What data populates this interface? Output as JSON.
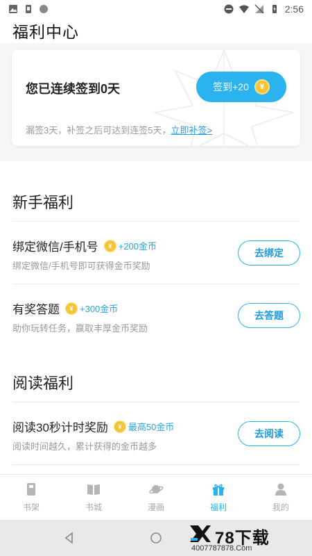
{
  "status_bar": {
    "time": "2:56"
  },
  "header": {
    "title": "福利中心"
  },
  "checkin": {
    "title": "您已连续签到0天",
    "button_label": "签到+20",
    "coin_glyph": "¥",
    "note": "漏签3天，补签之后可达到连签5天，",
    "makeup_link": "立即补签>"
  },
  "newbie": {
    "title": "新手福利",
    "tasks": [
      {
        "name": "绑定微信/手机号",
        "reward": "+200金币",
        "desc": "绑定微信/手机号即可获得金币奖励",
        "button": "去绑定"
      },
      {
        "name": "有奖答题",
        "reward": "+300金币",
        "desc": "助你玩转任务，赢取丰厚金币奖励",
        "button": "去答题"
      }
    ]
  },
  "reading": {
    "title": "阅读福利",
    "tasks": [
      {
        "name": "阅读30秒计时奖励",
        "reward": "最高50金币",
        "desc": "阅读时间越久，累计获得的金币越多",
        "button": "去阅读"
      }
    ]
  },
  "tabbar": {
    "items": [
      {
        "label": "书架",
        "icon": "bookshelf-icon"
      },
      {
        "label": "书城",
        "icon": "book-open-icon"
      },
      {
        "label": "漫画",
        "icon": "planet-icon"
      },
      {
        "label": "福利",
        "icon": "gift-icon"
      },
      {
        "label": "我的",
        "icon": "person-icon"
      }
    ],
    "active_color": "#2ab3ee"
  },
  "watermark": {
    "main": "78下载",
    "url": "4007787878.Com"
  },
  "colors": {
    "accent": "#2ab3ee",
    "coin": "#f5c43a"
  }
}
